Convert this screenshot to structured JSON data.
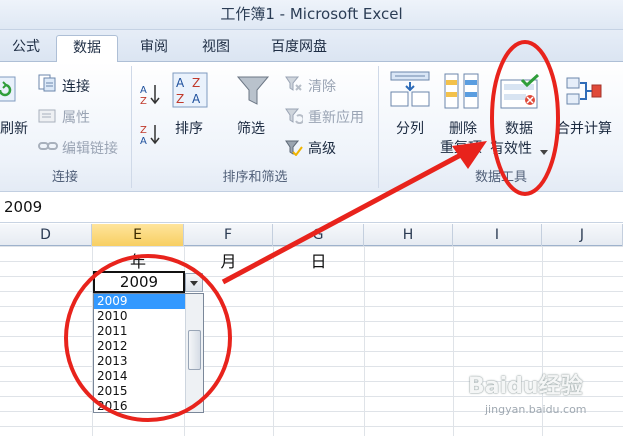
{
  "title_bar": {
    "text": "工作簿1 - Microsoft Excel"
  },
  "tabs": [
    {
      "label": "公式"
    },
    {
      "label": "数据",
      "active": true
    },
    {
      "label": "审阅"
    },
    {
      "label": "视图"
    },
    {
      "label": "百度网盘"
    }
  ],
  "ribbon": {
    "connections": {
      "refresh_label": "刷新",
      "connections_label": "连接",
      "properties_label": "属性",
      "edit_links_label": "编辑链接",
      "group_label": "连接"
    },
    "sort_filter": {
      "sort_label": "排序",
      "filter_label": "筛选",
      "clear_label": "清除",
      "reapply_label": "重新应用",
      "advanced_label": "高级",
      "group_label": "排序和筛选"
    },
    "data_tools": {
      "text_to_columns_label": "分列",
      "remove_dup_line1": "删除",
      "remove_dup_line2": "重复项",
      "validation_line1": "数据",
      "validation_line2": "有效性",
      "consolidate_label": "合并计算",
      "group_label": "数据工具"
    }
  },
  "formula_bar": {
    "value": "2009"
  },
  "columns": [
    "D",
    "E",
    "F",
    "G",
    "H",
    "I",
    "J"
  ],
  "cells": {
    "e_header": "年",
    "f_header": "月",
    "g_header": "日"
  },
  "active_cell": {
    "value": "2009"
  },
  "dropdown": {
    "items": [
      "2009",
      "2010",
      "2011",
      "2012",
      "2013",
      "2014",
      "2015",
      "2016"
    ],
    "selected": "2009"
  },
  "colors": {
    "annotation_red": "#e8231c",
    "selection_blue": "#3399ff",
    "active_col": "#f7cf62"
  },
  "watermark": {
    "brand": "Baidu经验",
    "url": "jingyan.baidu.com"
  }
}
